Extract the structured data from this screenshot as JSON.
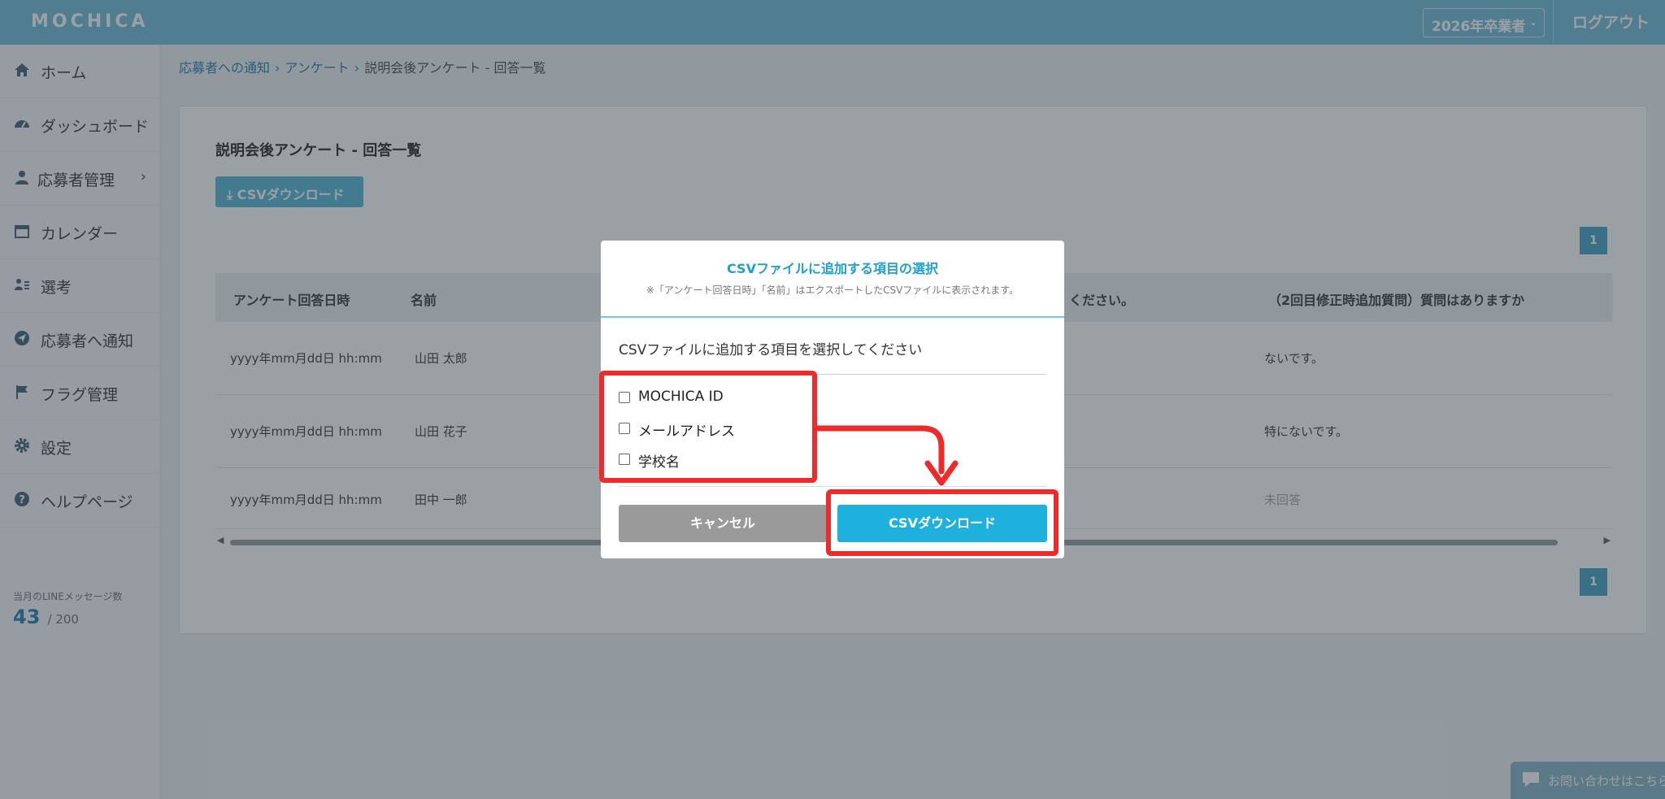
{
  "header": {
    "logo": "MOCHICA",
    "year_select": "2026年卒業者",
    "logout": "ログアウト"
  },
  "sidebar": {
    "items": [
      {
        "icon": "home-icon",
        "label": "ホーム"
      },
      {
        "icon": "dashboard-icon",
        "label": "ダッシュボード"
      },
      {
        "icon": "person-icon",
        "label": "応募者管理"
      },
      {
        "icon": "calendar-icon",
        "label": "カレンダー"
      },
      {
        "icon": "selection-icon",
        "label": "選考"
      },
      {
        "icon": "send-icon",
        "label": "応募者へ通知"
      },
      {
        "icon": "flag-icon",
        "label": "フラグ管理"
      },
      {
        "icon": "gear-icon",
        "label": "設定"
      },
      {
        "icon": "help-icon",
        "label": "ヘルプページ"
      }
    ],
    "line_label": "当月のLINEメッセージ数",
    "line_used": "43",
    "line_limit": "/ 200"
  },
  "breadcrumb": {
    "items": [
      "応募者への通知",
      "アンケート",
      "説明会後アンケート - 回答一覧"
    ]
  },
  "main": {
    "title": "説明会後アンケート - 回答一覧",
    "csv_button": "CSVダウンロード",
    "page_number": "1",
    "columns": [
      "アンケート回答日時",
      "名前",
      "ください。",
      "（2回目修正時追加質問）質問はありますか"
    ],
    "rows": [
      {
        "datetime": "yyyy年mm月dd日 hh:mm",
        "name": "山田 太郎",
        "answer": "ないです。"
      },
      {
        "datetime": "yyyy年mm月dd日 hh:mm",
        "name": "山田 花子",
        "answer": "特にないです。"
      },
      {
        "datetime": "yyyy年mm月dd日 hh:mm",
        "name": "田中 一郎",
        "answer": "未回答"
      }
    ]
  },
  "modal": {
    "title": "CSVファイルに追加する項目の選択",
    "note": "※「アンケート回答日時」「名前」はエクスポートしたCSVファイルに表示されます。",
    "prompt": "CSVファイルに追加する項目を選択してください",
    "options": [
      "MOCHICA ID",
      "メールアドレス",
      "学校名"
    ],
    "cancel": "キャンセル",
    "download": "CSVダウンロード"
  },
  "chat": {
    "label": "お問い合わせはこちら"
  },
  "colors": {
    "header": "#7ac0da",
    "accent": "#1fb1dd",
    "highlight": "#ee2a2a"
  }
}
